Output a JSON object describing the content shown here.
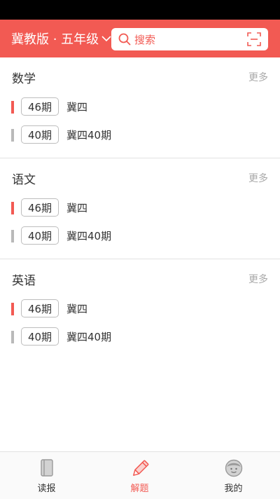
{
  "header": {
    "grade_label": "冀教版 · 五年级",
    "search_placeholder": "搜索"
  },
  "sections": [
    {
      "title": "数学",
      "more_label": "更多",
      "items": [
        {
          "tag": "46期",
          "title": "冀四",
          "active": true
        },
        {
          "tag": "40期",
          "title": "冀四40期",
          "active": false
        }
      ]
    },
    {
      "title": "语文",
      "more_label": "更多",
      "items": [
        {
          "tag": "46期",
          "title": "冀四",
          "active": true
        },
        {
          "tag": "40期",
          "title": "冀四40期",
          "active": false
        }
      ]
    },
    {
      "title": "英语",
      "more_label": "更多",
      "items": [
        {
          "tag": "46期",
          "title": "冀四",
          "active": true
        },
        {
          "tag": "40期",
          "title": "冀四40期",
          "active": false
        }
      ]
    }
  ],
  "tabs": [
    {
      "label": "读报",
      "icon": "book-icon",
      "active": false
    },
    {
      "label": "解题",
      "icon": "pencil-icon",
      "active": true
    },
    {
      "label": "我的",
      "icon": "avatar-icon",
      "active": false
    }
  ],
  "colors": {
    "accent": "#f25a53",
    "inactive_bar": "#b9b9b9",
    "muted_text": "#a8a8a8"
  }
}
